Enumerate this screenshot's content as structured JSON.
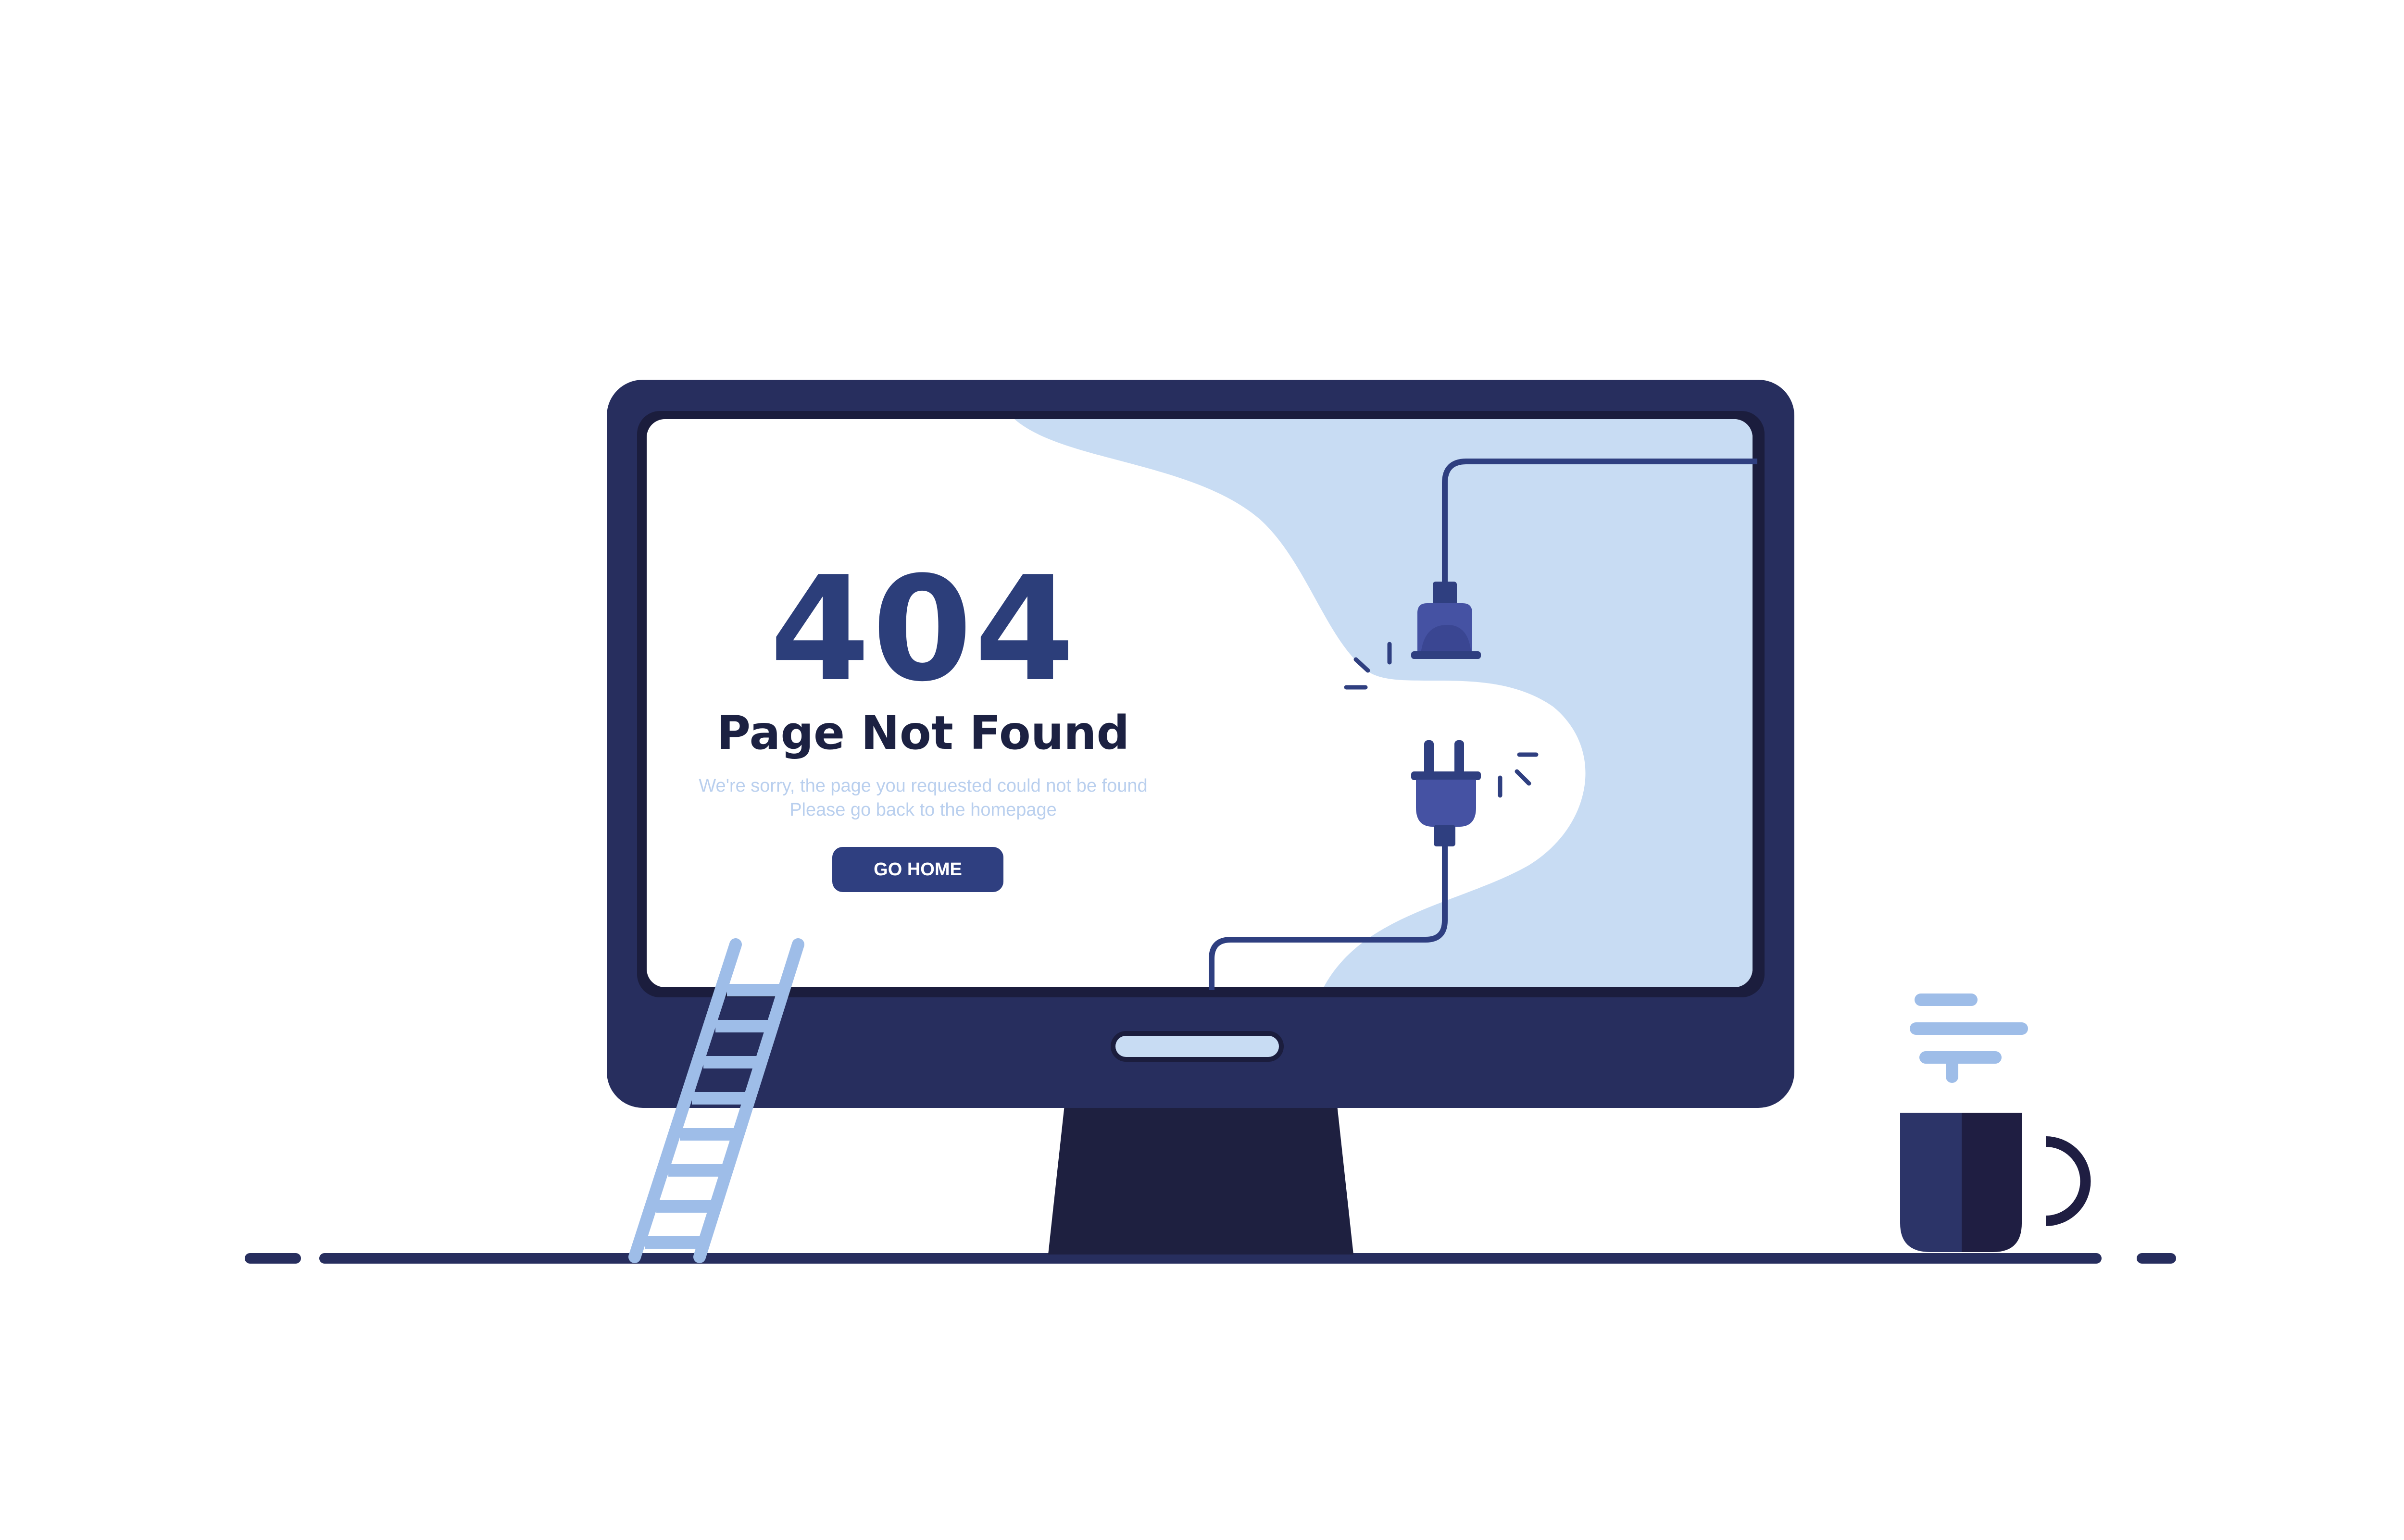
{
  "error": {
    "code": "404",
    "title": "Page Not Found",
    "message_line1": "We're sorry, the page you requested could not be found",
    "message_line2": "Please go back to the homepage"
  },
  "actions": {
    "go_home_label": "GO HOME"
  },
  "colors": {
    "monitor_frame": "#272e5e",
    "monitor_stand": "#1e2040",
    "screen_bg": "#ffffff",
    "screen_blob": "#c8dcf3",
    "accent_dark_blue": "#2f3f80",
    "plug_blue": "#4552a3",
    "ladder": "#9ebde8",
    "steam": "#9ebde8",
    "mug_left": "#2c3468",
    "mug_right": "#1f1e42"
  },
  "icons": {
    "unplugged_plug": "plug-icon",
    "unplugged_socket": "socket-connector-icon",
    "ladder": "ladder-icon",
    "coffee_mug": "coffee-mug-icon",
    "steam": "steam-icon"
  }
}
